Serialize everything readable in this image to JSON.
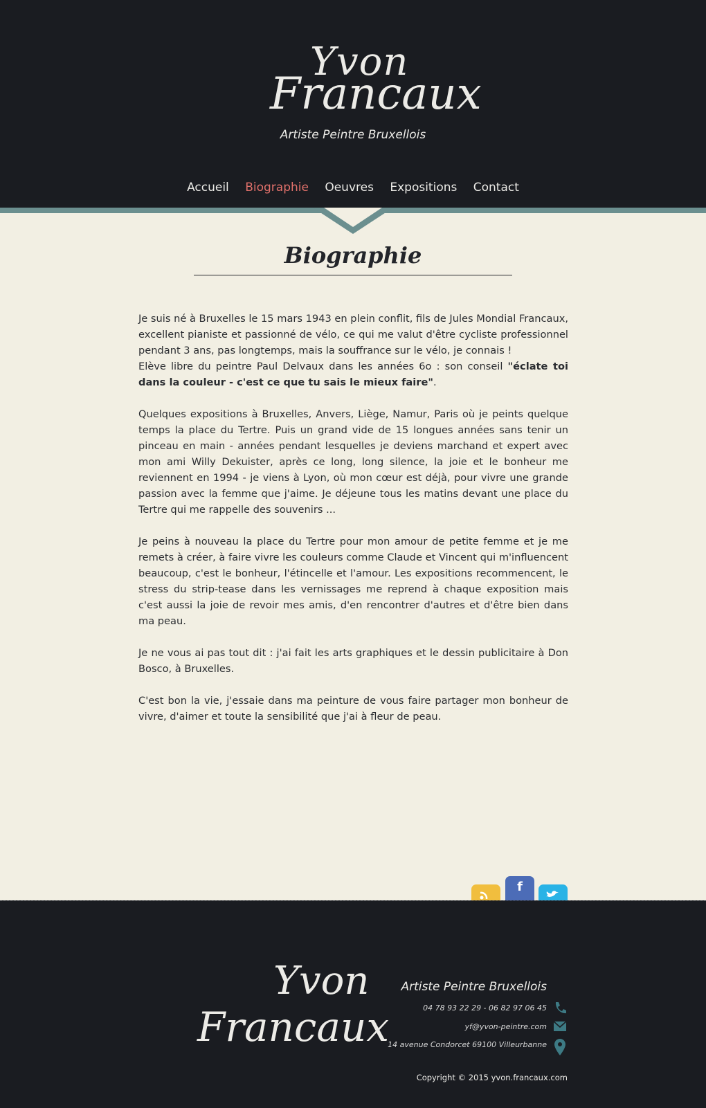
{
  "header": {
    "logo_first": "Yvon",
    "logo_last": "Francaux",
    "tagline": "Artiste Peintre Bruxellois"
  },
  "nav": {
    "items": [
      {
        "label": "Accueil"
      },
      {
        "label": "Biographie"
      },
      {
        "label": "Oeuvres"
      },
      {
        "label": "Expositions"
      },
      {
        "label": "Contact"
      }
    ],
    "active": "Biographie"
  },
  "main": {
    "title": "Biographie",
    "p1": "Je suis né à Bruxelles le 15 mars 1943 en plein conflit, fils de Jules Mondial Francaux, excellent pianiste et passionné de vélo, ce qui me valut d'être cycliste professionnel pendant 3 ans, pas longtemps, mais la souffrance sur le vélo, je connais !",
    "p1b_lead": "Elève libre du peintre Paul Delvaux dans les années 6o : son conseil ",
    "p1b_quote": "\"éclate toi dans la couleur - c'est ce que tu sais le mieux faire\"",
    "p1b_end": ".",
    "p2": "Quelques expositions à Bruxelles, Anvers, Liège, Namur, Paris où je peints quelque temps la place du Tertre. Puis un grand vide de 15 longues années sans tenir un pinceau en main - années pendant lesquelles je deviens marchand et expert avec mon ami Willy Dekuister, après ce long, long silence, la joie et le bonheur me reviennent en 1994 - je viens à Lyon, où mon cœur est déjà, pour vivre une grande passion avec la femme que j'aime. Je déjeune tous les matins devant une place du Tertre qui me rappelle des souvenirs ...",
    "p3": "Je peins à nouveau la place du Tertre pour mon amour de petite femme et je me remets à créer, à faire vivre les couleurs comme Claude et Vincent qui m'influencent beaucoup, c'est le bonheur, l'étincelle et l'amour. Les expositions recommencent, le stress du strip-tease dans les vernissages me reprend à chaque exposition mais c'est aussi la joie de revoir mes amis, d'en rencontrer d'autres et d'être bien dans ma peau.",
    "p4": "Je ne vous ai pas tout dit : j'ai fait les arts graphiques et le dessin publicitaire à Don Bosco, à Bruxelles.",
    "p5": "C'est bon la vie, j'essaie dans ma peinture de vous faire partager mon bonheur de vivre, d'aimer et toute la sensibilité que j'ai à fleur de peau."
  },
  "social": {
    "fb_glyph": "f",
    "colors": {
      "rss": "#f1be3e",
      "facebook": "#4c6cb7",
      "twitter": "#29b3e6"
    }
  },
  "footer": {
    "logo_first": "Yvon",
    "logo_last": "Francaux",
    "tagline": "Artiste Peintre Bruxellois",
    "phone": "04 78 93 22 29 - 06 82 97 06 45",
    "email": "yf@yvon-peintre.com",
    "address": "14 avenue Condorcet  69100 Villeurbanne",
    "copyright": "Copyright © 2015 yvon.francaux.com",
    "icon_color": "#3d7a84"
  }
}
